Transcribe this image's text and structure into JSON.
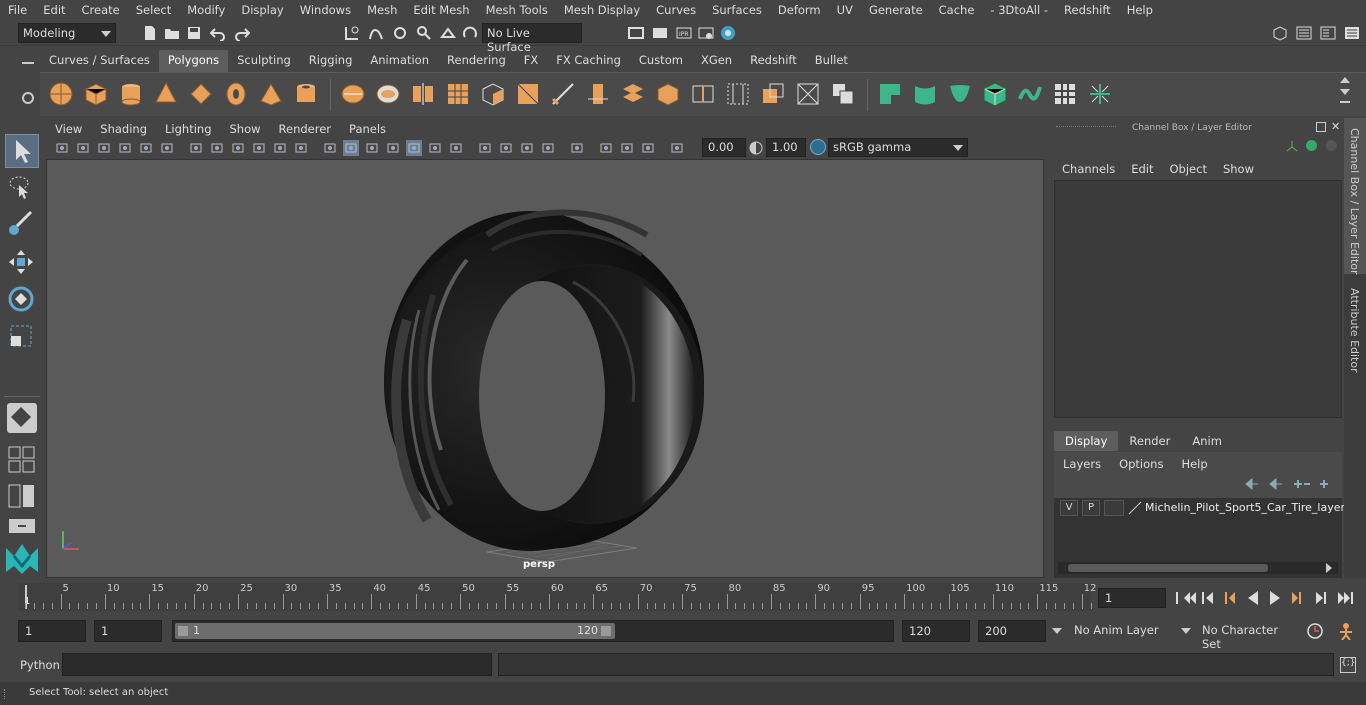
{
  "menu": [
    "File",
    "Edit",
    "Create",
    "Select",
    "Modify",
    "Display",
    "Windows",
    "Mesh",
    "Edit Mesh",
    "Mesh Tools",
    "Mesh Display",
    "Curves",
    "Surfaces",
    "Deform",
    "UV",
    "Generate",
    "Cache",
    "- 3DtoAll -",
    "Redshift",
    "Help"
  ],
  "status": {
    "mode": "Modeling",
    "live_surface": "No Live Surface"
  },
  "shelf_tabs": [
    "Curves / Surfaces",
    "Polygons",
    "Sculpting",
    "Rigging",
    "Animation",
    "Rendering",
    "FX",
    "FX Caching",
    "Custom",
    "XGen",
    "Redshift",
    "Bullet"
  ],
  "shelf_active": "Polygons",
  "viewport_menu": [
    "View",
    "Shading",
    "Lighting",
    "Show",
    "Renderer",
    "Panels"
  ],
  "viewport_toolbar": {
    "exposure": "0.00",
    "gamma": "1.00",
    "color_space": "sRGB gamma"
  },
  "viewport": {
    "camera_label": "persp"
  },
  "channel_box": {
    "title": "Channel Box / Layer Editor",
    "menu": [
      "Channels",
      "Edit",
      "Object",
      "Show"
    ]
  },
  "layer_editor": {
    "tabs": [
      "Display",
      "Render",
      "Anim"
    ],
    "active_tab": "Display",
    "menu": [
      "Layers",
      "Options",
      "Help"
    ],
    "layer": {
      "v": "V",
      "p": "P",
      "name": "Michelin_Pilot_Sport5_Car_Tire_layer"
    }
  },
  "side_tabs": [
    "Channel Box / Layer Editor",
    "Attribute Editor"
  ],
  "timeline": {
    "ticks": [
      "5",
      "10",
      "15",
      "20",
      "25",
      "30",
      "35",
      "40",
      "45",
      "50",
      "55",
      "60",
      "65",
      "70",
      "75",
      "80",
      "85",
      "90",
      "95",
      "100",
      "105",
      "110",
      "115",
      "12"
    ],
    "start_mark": "1",
    "current_frame": "1"
  },
  "range": {
    "start": "1",
    "playback_start": "1",
    "slider_start": "1",
    "slider_end": "120",
    "playback_end": "120",
    "end": "200",
    "anim_layer": "No Anim Layer",
    "character_set": "No Character Set"
  },
  "command": {
    "language": "Python"
  },
  "help_text": "Select Tool: select an object",
  "colors": {
    "accent": "#5285a6",
    "shelf_orange": "#e8a05a",
    "shelf_green": "#3fb58c"
  }
}
